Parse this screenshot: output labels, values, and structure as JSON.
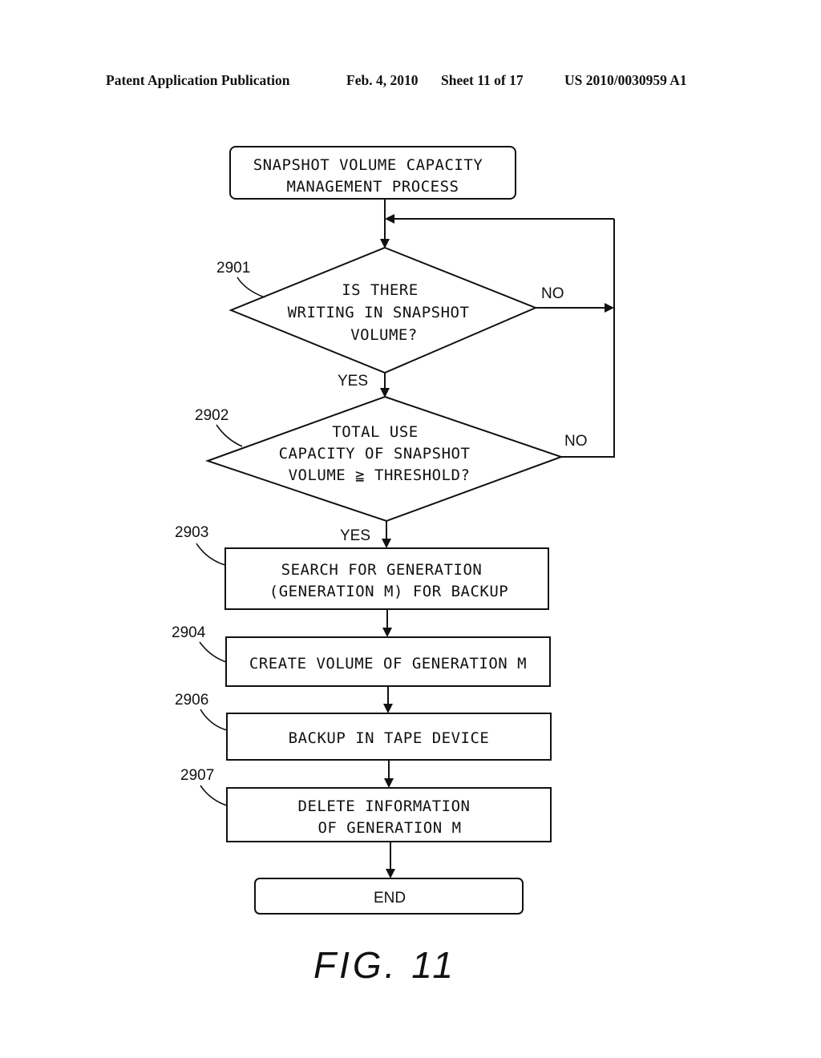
{
  "header": {
    "publication": "Patent Application Publication",
    "date": "Feb. 4, 2010",
    "sheet": "Sheet 11 of 17",
    "number": "US 2010/0030959 A1"
  },
  "flowchart": {
    "start": {
      "lines": [
        "SNAPSHOT VOLUME CAPACITY",
        "MANAGEMENT PROCESS"
      ]
    },
    "decisions": [
      {
        "ref": "2901",
        "lines": [
          "IS THERE",
          "WRITING IN SNAPSHOT",
          "VOLUME?"
        ],
        "yes_label": "YES",
        "no_label": "NO"
      },
      {
        "ref": "2902",
        "lines": [
          "TOTAL USE",
          "CAPACITY OF SNAPSHOT",
          "VOLUME ≧ THRESHOLD?"
        ],
        "yes_label": "YES",
        "no_label": "NO"
      }
    ],
    "steps": [
      {
        "ref": "2903",
        "lines": [
          "SEARCH FOR GENERATION",
          "(GENERATION M) FOR BACKUP"
        ]
      },
      {
        "ref": "2904",
        "lines": [
          "CREATE VOLUME OF GENERATION M"
        ]
      },
      {
        "ref": "2906",
        "lines": [
          "BACKUP IN TAPE DEVICE"
        ]
      },
      {
        "ref": "2907",
        "lines": [
          "DELETE INFORMATION",
          "OF GENERATION M"
        ]
      }
    ],
    "end": {
      "label": "END"
    }
  },
  "figure_label": "FIG. 11"
}
